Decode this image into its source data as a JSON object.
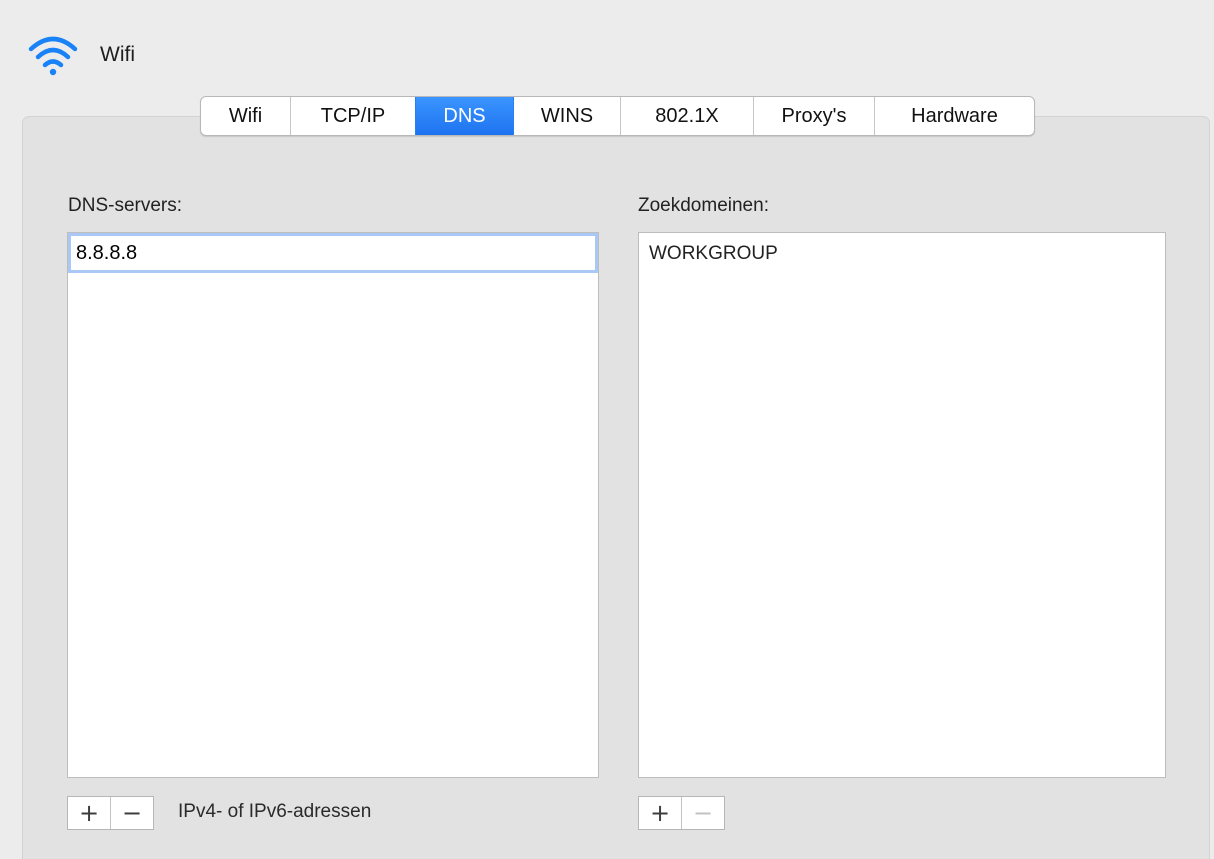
{
  "header": {
    "title": "Wifi",
    "icon": "wifi-icon"
  },
  "tabs": [
    {
      "label": "Wifi",
      "active": false
    },
    {
      "label": "TCP/IP",
      "active": false
    },
    {
      "label": "DNS",
      "active": true
    },
    {
      "label": "WINS",
      "active": false
    },
    {
      "label": "802.1X",
      "active": false
    },
    {
      "label": "Proxy's",
      "active": false
    },
    {
      "label": "Hardware",
      "active": false
    }
  ],
  "dns": {
    "label": "DNS-servers:",
    "entry_value": "8.8.8.8",
    "add_label": "+",
    "remove_label": "−",
    "hint": "IPv4- of IPv6-adressen"
  },
  "search": {
    "label": "Zoekdomeinen:",
    "items": [
      "WORKGROUP"
    ],
    "add_label": "+",
    "remove_label": "−"
  },
  "colors": {
    "accent": "#1d73f0",
    "focus_ring": "#a9c8f5",
    "icon": "#1a82f7"
  }
}
